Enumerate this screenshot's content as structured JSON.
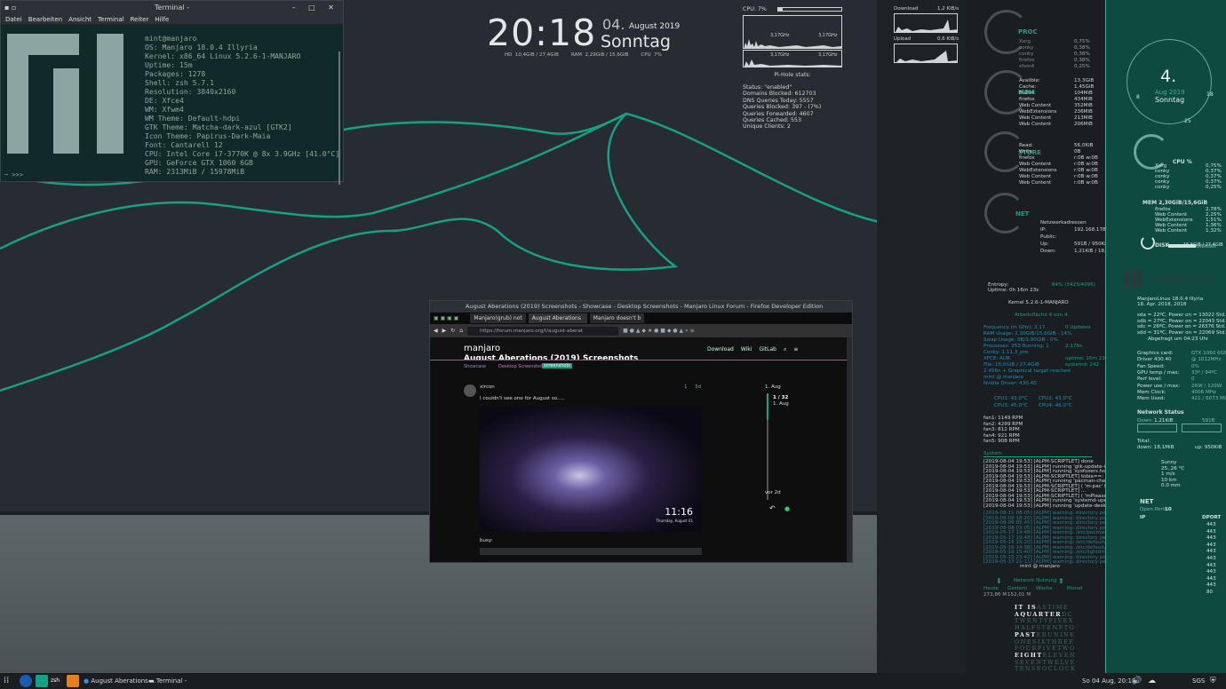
{
  "terminal": {
    "title": "Terminal -",
    "menu": [
      "Datei",
      "Bearbeiten",
      "Ansicht",
      "Terminal",
      "Reiter",
      "Hilfe"
    ],
    "lines": [
      "mint@manjaro",
      "OS: Manjaro 18.0.4 Illyria",
      "Kernel: x86_64 Linux 5.2.6-1-MANJARO",
      "Uptime: 15m",
      "Packages: 1278",
      "Shell: zsh 5.7.1",
      "Resolution: 3840x2160",
      "DE: Xfce4",
      "WM: Xfwm4",
      "WM Theme: Default-hdpi",
      "GTK Theme: Matcha-dark-azul [GTK2]",
      "Icon Theme: Papirus-Dark-Maia",
      "Font: Cantarell 12",
      "CPU: Intel Core i7-3770K @ 8x 3.9GHz [41.0°C]",
      "GPU: GeForce GTX 1060 6GB",
      "RAM: 2313MiB / 15978MiB"
    ],
    "prompt": "~ >>>"
  },
  "clock": {
    "time": "20:18",
    "day": "04.",
    "month": "August 2019",
    "weekday": "Sonntag",
    "hd_label": "HD",
    "hd": "10,4GiB / 27,4GiB",
    "ram_label": "RAM",
    "ram": "2,29GiB / 15,6GiB",
    "cpu_label": "CPU",
    "cpu": "7%"
  },
  "pihole": {
    "cpu": "CPU: 7%",
    "freq1": "3,17GHz",
    "freq2": "3,17GHz",
    "freq3": "3,17GHz",
    "freq4": "3,17GHz",
    "title": "Pi-Hole stats:",
    "stats": [
      "Status: \"enabled\"",
      "Domains Blocked: 612703",
      "DNS Queries Today: 5557",
      "Queries Blocked: 397 - (7%)",
      "Queries Forwarded: 4607",
      "Queries Cached: 553",
      "Unique Clients: 2"
    ]
  },
  "net_small": {
    "download": "Download",
    "download_val": "1,2 KiB/s",
    "upload": "Upload",
    "upload_val": "0,6 KiB/s"
  },
  "conky_mid": {
    "proc": {
      "title": "PROC",
      "rows": [
        [
          "Xorg",
          "0,75%"
        ],
        [
          "conky",
          "0,38%"
        ],
        [
          "conky",
          "0,38%"
        ],
        [
          "firefox",
          "0,38%"
        ],
        [
          "xfsm4",
          "0,25%"
        ]
      ]
    },
    "mem": {
      "title": "MEM",
      "rows": [
        [
          "Availble:",
          "13,3GiB"
        ],
        [
          "Cache:",
          "1,45GiB"
        ],
        [
          "Buffer:",
          "104MiB"
        ],
        [
          "firefox",
          "434MiB"
        ],
        [
          "Web Content",
          "352MiB"
        ],
        [
          "WebExtensions",
          "236MiB"
        ],
        [
          "Web Content",
          "213MiB"
        ],
        [
          "Web Content",
          "206MiB"
        ]
      ]
    },
    "store": {
      "title": "STORE",
      "rows": [
        [
          "Read:",
          "56,0KiB"
        ],
        [
          "Write:",
          "0B"
        ],
        [
          "firefox",
          "r:0B w:0B"
        ],
        [
          "Web Content",
          "r:0B w:0B"
        ],
        [
          "WebExtensions",
          "r:0B w:0B"
        ],
        [
          "Web Content",
          "r:0B w:0B"
        ],
        [
          "Web Content",
          "r:0B w:0B"
        ]
      ]
    },
    "net": {
      "title": "NET",
      "rows": [
        [
          "Netzwerkadressen",
          ""
        ],
        [
          "IP:",
          "192.168.178.31"
        ],
        [
          "Public:",
          ""
        ],
        [
          "Up:",
          "591B / 950KiB"
        ],
        [
          "Down:",
          "1,21KiB / 18,1"
        ]
      ]
    },
    "entropy": "Entropy:",
    "entropy_val": "84% (3423/4096)",
    "uptime": "Uptime: 0h 16m 23s",
    "kernel": "Kernel 5.2.6-1-MANJARO",
    "workspace": "Arbeitsfläche 4 von 4",
    "sys": [
      "Frequency (in GHz): 3,17",
      "RAM Usage: 2,30GiB/15,6GiB - 14%",
      "Swap Usage: 0B/3,90GiB - 0%",
      "Processes: 253 Running: 1",
      "Conky: 1.11.3_pre",
      "XFCE: AUR",
      "File: 15,6GiB / 27,4GiB",
      "2.456n + Graphical target reached",
      "mint @ manjaro",
      "Nvidia Driver: 430.40"
    ],
    "sys_right": [
      "0 Updates",
      "",
      "",
      "2.176s",
      "",
      "uptime: 16m 23s",
      "systemd: 242"
    ],
    "boot": "Boot Time (Kernel)",
    "temps": [
      "CPU1: 43.0°C",
      "CPU2: 43.0°C",
      "CPU3: 45.0°C",
      "CPU4: 46.0°C"
    ],
    "fans": [
      "fan1: 1149 RPM",
      "fan2: 4299 RPM",
      "fan3: 812 RPM",
      "fan4: 921 RPM",
      "fan5: 908 RPM"
    ],
    "system": "System",
    "logs": [
      "[2019-08-04 19:53] [ALPM-SCRIPTLET] done",
      "[2019-08-04 19:53] [ALPM] running 'gtk-update-icon-cache.h",
      "[2019-08-04 19:53] [ALPM] running 'sysfusers.hook'...",
      "[2019-08-04 19:53] [ALPM-SCRIPTLET] tobia==: 1.0.93-3",
      "[2019-08-04 19:53] [ALPM] running 'pacman-check.hook'...",
      "[2019-08-04 19:53] [ALPM-SCRIPTLET] ( 'm-pac' files found",
      "[2019-08-04 19:53] [ALPM-SCRIPTLET] ...",
      "[2019-08-04 19:53] [ALPM-SCRIPTLET] ( 'mPlease check and",
      "[2019-08-04 19:53] [ALPM] running 'systemd-update.hook'...",
      "[2019-08-04 19:53] [ALPM] running 'update-desktop-databas"
    ],
    "logs2": [
      "[2019-08-11 08:05] [ALPM] warning: directory permissions dif",
      "[2019-08-08 18:20] [ALPM] warning: directory permissions dif",
      "[2019-08-06 05:45] [ALPM] warning: directory permissions dif",
      "[2019-08-08 03:05] [ALPM] warning: directory permissions dif",
      "[2019-05-17 19:48] [ALPM] warning: /etc/pacman.d/mirrorlist",
      "[2019-05-17 19:48] [ALPM] warning: directory permissions dif",
      "[2019-05-16 15:20] [ALPM] warning: /etc/default/grub installe",
      "[2019-05-16 14:38] [ALPM] warning: /etc/default/grub installe",
      "[2019-05-16 15:40] [ALPM] warning: /etc/lightdm/lightdm.co",
      "[2019-05-15 23:42] [ALPM] warning: directory permissions dif",
      "[2019-05-13 21:11] [ALPM] warning: directory permissions dif"
    ],
    "footer_user": "mint @ manjaro",
    "netuse": "Network Nutzung",
    "netcols": [
      "Heute",
      "Gestern",
      "Woche",
      "Monat"
    ],
    "netvals": [
      "273,86 M",
      "152,01 M"
    ]
  },
  "conky_right": {
    "date": "4.",
    "month": "Aug 2019",
    "weekday": "Sonntag",
    "n8": "8",
    "n18": "18",
    "n25": "25",
    "cpu": "CPU %",
    "cpu_rows": [
      [
        "Xorg",
        "0,75%"
      ],
      [
        "conky",
        "0,37%"
      ],
      [
        "conky",
        "0,37%"
      ],
      [
        "conky",
        "0,37%"
      ],
      [
        "conky",
        "0,25%"
      ]
    ],
    "mem": "MEM 2,30GiB/15,6GiB",
    "mem_rows": [
      [
        "firefox",
        "2,78%"
      ],
      [
        "Web Content",
        "2,25%"
      ],
      [
        "WebExtensions",
        "1,51%"
      ],
      [
        "Web Content",
        "1,36%"
      ],
      [
        "Web Content",
        "1,32%"
      ]
    ],
    "disk": "DISK",
    "disk_val": "15,5GiB / 27,4GiB",
    "brand": "manjaro xfce",
    "ver": "ManjaroLinux 18.0.4 Illyria",
    "ver2": "18. Apr. 2018, 2018",
    "drives": [
      "sda = 22ºC, Power on = 13022 Std.",
      "sdb = 27ºC, Power on = 22043 Std.",
      "sdc = 26ºC, Power on = 26376 Std.",
      "sdd = 31ºC, Power on = 22069 Std."
    ],
    "fetched": "Abgefragt um 04:23 Uhr",
    "gpu": [
      [
        "Graphics card:",
        "GTX 1060 6GB"
      ],
      [
        "Driver 430.40",
        "@ 1012MHz"
      ],
      [
        "Fan Speed:",
        "0%"
      ],
      [
        "GPU temp / max:",
        "33º / 94ºC"
      ],
      [
        "Perf level:",
        "0"
      ],
      [
        "Power use / max:",
        "26W / 120W"
      ],
      [
        "Mem Clock:",
        "4006 MHz"
      ],
      [
        "Mem Used:",
        "421 / 6073 MiB"
      ]
    ],
    "netstatus": "Network Status",
    "down_lbl": "Down:",
    "down_val": "1,21KiB",
    "up_val": "591B",
    "total": "Total:",
    "total_down": "down: 18,1MiB",
    "total_up": "up: 950KiB",
    "weather": [
      "Sunny",
      "25..26 °C",
      "1 m/s",
      "10 km",
      "0.0 mm"
    ],
    "net": "NET",
    "openports": "Open Ports:",
    "openports_val": "10",
    "ip": "IP",
    "dport": "DPORT",
    "ports": [
      "443",
      "443",
      "443",
      "443",
      "443",
      "443",
      "443",
      "443",
      "443",
      "443",
      "80"
    ]
  },
  "wordclock": {
    "lines": [
      [
        "IT",
        "IS",
        "ASTIME"
      ],
      [
        "",
        "A",
        "QUARTER",
        "DC"
      ],
      [
        "TWENTYFIVEX"
      ],
      [
        "HALFSTENFTO"
      ],
      [
        "",
        "PAST",
        "ERUNINE"
      ],
      [
        "ONESIXTHREE"
      ],
      [
        "FOURFIVETWO"
      ],
      [
        "",
        "EIGHT",
        "ELEVEN"
      ],
      [
        "SEVENTWELVE"
      ],
      [
        "TENSEOCLOCK"
      ]
    ]
  },
  "firefox": {
    "title": "August Aberations (2019) Screenshots - Showcase - Desktop Screenshots - Manjaro Linux Forum - Firefox Developer Edition",
    "tabs": [
      "Manjaro(grub) not",
      "August Aberations",
      "Manjaro doesn't b"
    ],
    "url": "https://forum.manjaro.org/t/august-aberat",
    "site": "manjaro",
    "nav": [
      "Download",
      "Wiki",
      "GitLab"
    ],
    "page_title": "August Aberations (2019) Screenshots",
    "crumbs": [
      "Showcase",
      "Desktop Screenshots"
    ],
    "tag": "screenshots",
    "user": "xircon",
    "date": "3d",
    "post_count": "1",
    "text": "I couldn't see one for August so.....",
    "shot_time": "11:16",
    "shot_date": "Thursday, August 01",
    "busy": "busy:",
    "timeline_top": "1. Aug",
    "timeline_pos": "1 / 32",
    "timeline_sub": "1. Aug",
    "timeline_end": "vor 2d"
  },
  "taskbar": {
    "tasks": [
      "August Aberations ...",
      "Terminal -"
    ],
    "clock": "So 04 Aug, 20:18",
    "sgs": "SGS"
  }
}
